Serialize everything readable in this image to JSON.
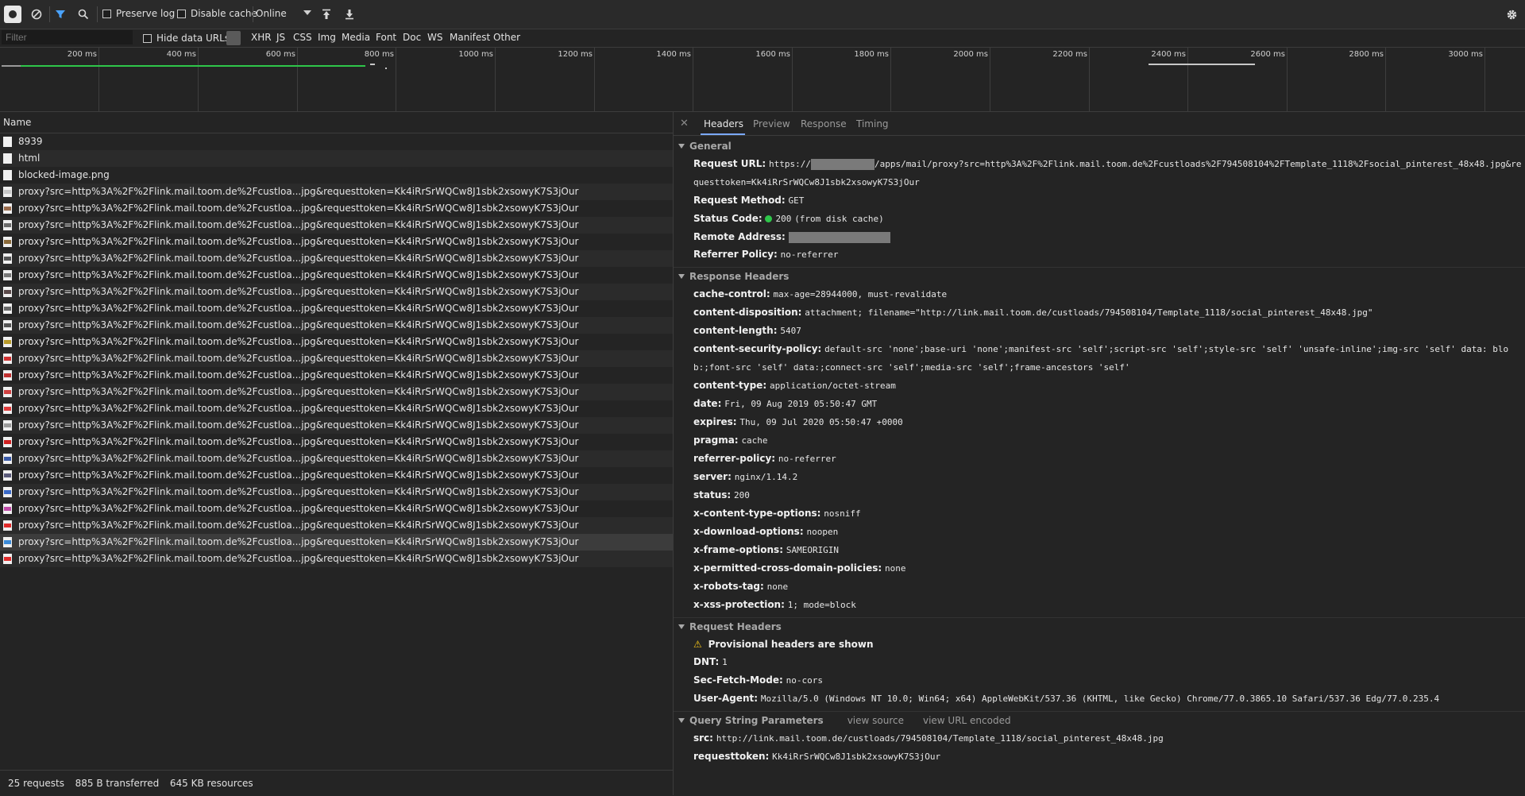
{
  "toolbar": {
    "preserve_log": "Preserve log",
    "disable_cache": "Disable cache",
    "throttle": "Online"
  },
  "filterbar": {
    "placeholder": "Filter",
    "hide_data_urls": "Hide data URLs",
    "types": [
      "XHR",
      "JS",
      "CSS",
      "Img",
      "Media",
      "Font",
      "Doc",
      "WS",
      "Manifest",
      "Other"
    ]
  },
  "timeline": {
    "ticks": [
      "200 ms",
      "400 ms",
      "600 ms",
      "800 ms",
      "1000 ms",
      "1200 ms",
      "1400 ms",
      "1600 ms",
      "1800 ms",
      "2000 ms",
      "2200 ms",
      "2400 ms",
      "2600 ms",
      "2800 ms",
      "3000 ms"
    ]
  },
  "requests": {
    "header": "Name",
    "items": [
      {
        "name": "8939",
        "icon_color": "#f0f0f0"
      },
      {
        "name": "html",
        "icon_color": "#f0f0f0"
      },
      {
        "name": "blocked-image.png",
        "icon_color": "#f0f0f0"
      },
      {
        "name": "proxy?src=http%3A%2F%2Flink.mail.toom.de%2Fcustloa...jpg&requesttoken=Kk4iRrSrWQCw8J1sbk2xsowyK7S3jOur",
        "icon_color": "#c8c8c8"
      },
      {
        "name": "proxy?src=http%3A%2F%2Flink.mail.toom.de%2Fcustloa...jpg&requesttoken=Kk4iRrSrWQCw8J1sbk2xsowyK7S3jOur",
        "icon_color": "#9a6b4b"
      },
      {
        "name": "proxy?src=http%3A%2F%2Flink.mail.toom.de%2Fcustloa...jpg&requesttoken=Kk4iRrSrWQCw8J1sbk2xsowyK7S3jOur",
        "icon_color": "#6b6b6b"
      },
      {
        "name": "proxy?src=http%3A%2F%2Flink.mail.toom.de%2Fcustloa...jpg&requesttoken=Kk4iRrSrWQCw8J1sbk2xsowyK7S3jOur",
        "icon_color": "#8a6a3a"
      },
      {
        "name": "proxy?src=http%3A%2F%2Flink.mail.toom.de%2Fcustloa...jpg&requesttoken=Kk4iRrSrWQCw8J1sbk2xsowyK7S3jOur",
        "icon_color": "#555555"
      },
      {
        "name": "proxy?src=http%3A%2F%2Flink.mail.toom.de%2Fcustloa...jpg&requesttoken=Kk4iRrSrWQCw8J1sbk2xsowyK7S3jOur",
        "icon_color": "#777777"
      },
      {
        "name": "proxy?src=http%3A%2F%2Flink.mail.toom.de%2Fcustloa...jpg&requesttoken=Kk4iRrSrWQCw8J1sbk2xsowyK7S3jOur",
        "icon_color": "#5a4a4a"
      },
      {
        "name": "proxy?src=http%3A%2F%2Flink.mail.toom.de%2Fcustloa...jpg&requesttoken=Kk4iRrSrWQCw8J1sbk2xsowyK7S3jOur",
        "icon_color": "#666666"
      },
      {
        "name": "proxy?src=http%3A%2F%2Flink.mail.toom.de%2Fcustloa...jpg&requesttoken=Kk4iRrSrWQCw8J1sbk2xsowyK7S3jOur",
        "icon_color": "#555555"
      },
      {
        "name": "proxy?src=http%3A%2F%2Flink.mail.toom.de%2Fcustloa...jpg&requesttoken=Kk4iRrSrWQCw8J1sbk2xsowyK7S3jOur",
        "icon_color": "#b89a2a"
      },
      {
        "name": "proxy?src=http%3A%2F%2Flink.mail.toom.de%2Fcustloa...jpg&requesttoken=Kk4iRrSrWQCw8J1sbk2xsowyK7S3jOur",
        "icon_color": "#d03030"
      },
      {
        "name": "proxy?src=http%3A%2F%2Flink.mail.toom.de%2Fcustloa...jpg&requesttoken=Kk4iRrSrWQCw8J1sbk2xsowyK7S3jOur",
        "icon_color": "#c03030"
      },
      {
        "name": "proxy?src=http%3A%2F%2Flink.mail.toom.de%2Fcustloa...jpg&requesttoken=Kk4iRrSrWQCw8J1sbk2xsowyK7S3jOur",
        "icon_color": "#d04040"
      },
      {
        "name": "proxy?src=http%3A%2F%2Flink.mail.toom.de%2Fcustloa...jpg&requesttoken=Kk4iRrSrWQCw8J1sbk2xsowyK7S3jOur",
        "icon_color": "#e03a3a"
      },
      {
        "name": "proxy?src=http%3A%2F%2Flink.mail.toom.de%2Fcustloa...jpg&requesttoken=Kk4iRrSrWQCw8J1sbk2xsowyK7S3jOur",
        "icon_color": "#9a9a9a"
      },
      {
        "name": "proxy?src=http%3A%2F%2Flink.mail.toom.de%2Fcustloa...jpg&requesttoken=Kk4iRrSrWQCw8J1sbk2xsowyK7S3jOur",
        "icon_color": "#d02020"
      },
      {
        "name": "proxy?src=http%3A%2F%2Flink.mail.toom.de%2Fcustloa...jpg&requesttoken=Kk4iRrSrWQCw8J1sbk2xsowyK7S3jOur",
        "icon_color": "#3a5aa8"
      },
      {
        "name": "proxy?src=http%3A%2F%2Flink.mail.toom.de%2Fcustloa...jpg&requesttoken=Kk4iRrSrWQCw8J1sbk2xsowyK7S3jOur",
        "icon_color": "#5a5a7a"
      },
      {
        "name": "proxy?src=http%3A%2F%2Flink.mail.toom.de%2Fcustloa...jpg&requesttoken=Kk4iRrSrWQCw8J1sbk2xsowyK7S3jOur",
        "icon_color": "#3a6ac8"
      },
      {
        "name": "proxy?src=http%3A%2F%2Flink.mail.toom.de%2Fcustloa...jpg&requesttoken=Kk4iRrSrWQCw8J1sbk2xsowyK7S3jOur",
        "icon_color": "#c04aa8"
      },
      {
        "name": "proxy?src=http%3A%2F%2Flink.mail.toom.de%2Fcustloa...jpg&requesttoken=Kk4iRrSrWQCw8J1sbk2xsowyK7S3jOur",
        "icon_color": "#e02a2a"
      },
      {
        "name": "proxy?src=http%3A%2F%2Flink.mail.toom.de%2Fcustloa...jpg&requesttoken=Kk4iRrSrWQCw8J1sbk2xsowyK7S3jOur",
        "icon_color": "#3a8ad8"
      },
      {
        "name": "proxy?src=http%3A%2F%2Flink.mail.toom.de%2Fcustloa...jpg&requesttoken=Kk4iRrSrWQCw8J1sbk2xsowyK7S3jOur",
        "icon_color": "#e02a2a"
      }
    ],
    "selected_index": 24
  },
  "statusbar": {
    "requests": "25 requests",
    "transferred": "885 B transferred",
    "resources": "645 KB resources"
  },
  "details": {
    "tabs": [
      "Headers",
      "Preview",
      "Response",
      "Timing"
    ],
    "general": {
      "title": "General",
      "request_url_label": "Request URL:",
      "request_url_prefix": "https://",
      "request_url_rest": "/apps/mail/proxy?src=http%3A%2F%2Flink.mail.toom.de%2Fcustloads%2F794508104%2FTemplate_1118%2Fsocial_pinterest_48x48.jpg&requesttoken=Kk4iRrSrWQCw8J1sbk2xsowyK7S3jOur",
      "method_label": "Request Method:",
      "method": "GET",
      "status_label": "Status Code:",
      "status_code": "200",
      "status_note": "(from disk cache)",
      "remote_label": "Remote Address:",
      "referrer_label": "Referrer Policy:",
      "referrer": "no-referrer"
    },
    "response_headers": {
      "title": "Response Headers",
      "rows": [
        {
          "k": "cache-control:",
          "v": "max-age=28944000, must-revalidate"
        },
        {
          "k": "content-disposition:",
          "v": "attachment; filename=\"http://link.mail.toom.de/custloads/794508104/Template_1118/social_pinterest_48x48.jpg\""
        },
        {
          "k": "content-length:",
          "v": "5407"
        },
        {
          "k": "content-security-policy:",
          "v": "default-src 'none';base-uri 'none';manifest-src 'self';script-src 'self';style-src 'self' 'unsafe-inline';img-src 'self' data: blob:;font-src 'self' data:;connect-src 'self';media-src 'self';frame-ancestors 'self'"
        },
        {
          "k": "content-type:",
          "v": "application/octet-stream"
        },
        {
          "k": "date:",
          "v": "Fri, 09 Aug 2019 05:50:47 GMT"
        },
        {
          "k": "expires:",
          "v": "Thu, 09 Jul 2020 05:50:47 +0000"
        },
        {
          "k": "pragma:",
          "v": "cache"
        },
        {
          "k": "referrer-policy:",
          "v": "no-referrer"
        },
        {
          "k": "server:",
          "v": "nginx/1.14.2"
        },
        {
          "k": "status:",
          "v": "200"
        },
        {
          "k": "x-content-type-options:",
          "v": "nosniff"
        },
        {
          "k": "x-download-options:",
          "v": "noopen"
        },
        {
          "k": "x-frame-options:",
          "v": "SAMEORIGIN"
        },
        {
          "k": "x-permitted-cross-domain-policies:",
          "v": "none"
        },
        {
          "k": "x-robots-tag:",
          "v": "none"
        },
        {
          "k": "x-xss-protection:",
          "v": "1; mode=block"
        }
      ]
    },
    "request_headers": {
      "title": "Request Headers",
      "warning": "Provisional headers are shown",
      "rows": [
        {
          "k": "DNT:",
          "v": "1"
        },
        {
          "k": "Sec-Fetch-Mode:",
          "v": "no-cors"
        },
        {
          "k": "User-Agent:",
          "v": "Mozilla/5.0 (Windows NT 10.0; Win64; x64) AppleWebKit/537.36 (KHTML, like Gecko) Chrome/77.0.3865.10 Safari/537.36 Edg/77.0.235.4"
        }
      ]
    },
    "query_params": {
      "title": "Query String Parameters",
      "view_source": "view source",
      "view_url_encoded": "view URL encoded",
      "rows": [
        {
          "k": "src:",
          "v": "http://link.mail.toom.de/custloads/794508104/Template_1118/social_pinterest_48x48.jpg"
        },
        {
          "k": "requesttoken:",
          "v": "Kk4iRrSrWQCw8J1sbk2xsowyK7S3jOur"
        }
      ]
    }
  }
}
